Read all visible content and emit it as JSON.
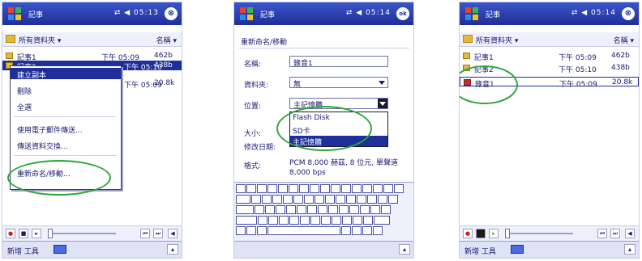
{
  "screens": [
    {
      "title": "記事",
      "status": "⇄ ◀ 05:13",
      "close_glyph": "⊗",
      "folder": "所有資料夾 ▾",
      "sort": "名稱 ▾",
      "rows": [
        {
          "name": "記事1",
          "time": "下午 05:09",
          "size": "462b"
        },
        {
          "name": "記事2",
          "time": "下午 05:10",
          "size": "438b"
        },
        {
          "name": "",
          "time": "下午 05:09",
          "size": "20.8k"
        }
      ],
      "menu": [
        "建立副本",
        "刪除",
        "全選",
        "使用電子郵件傳送...",
        "傳送資料交換...",
        "重新命名/移動..."
      ],
      "command": "新增 工具"
    },
    {
      "title": "記事",
      "status": "⇄ ◀ 05:14",
      "close_glyph": "ok",
      "form_title": "重新命名/移動",
      "name_label": "名稱:",
      "name_value": "錄音1",
      "folder_label": "資料夾:",
      "folder_value": "無",
      "location_label": "位置:",
      "location_value": "主記憶體",
      "options": [
        "Flash Disk",
        "SD卡",
        "主記憶體"
      ],
      "size_label": "大小:",
      "created_label": "修改日期:",
      "format_label": "格式:",
      "format_value": "PCM 8,000 赫茲, 8 位元, 單聲道 8,000 bps",
      "command": ""
    },
    {
      "title": "記事",
      "status": "⇄ ◀ 05:14",
      "close_glyph": "⊗",
      "folder": "所有資料夾 ▾",
      "sort": "名稱 ▾",
      "rows": [
        {
          "name": "記事1",
          "time": "下午 05:09",
          "size": "462b"
        },
        {
          "name": "記事2",
          "time": "下午 05:10",
          "size": "438b"
        },
        {
          "name": "錄音1",
          "time": "下午 05:09",
          "size": "20.8k"
        }
      ],
      "command": "新增 工具"
    }
  ]
}
